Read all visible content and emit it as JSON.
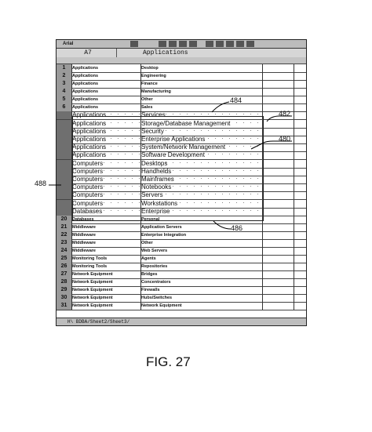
{
  "toolbar": {
    "font": "Arial"
  },
  "formula_bar": {
    "cell_ref": "A7",
    "value": "Applications"
  },
  "rows": [
    {
      "num": "1",
      "a": "Applications",
      "b": "Desktop",
      "style": "small"
    },
    {
      "num": "2",
      "a": "Applications",
      "b": "Engineering",
      "style": "small"
    },
    {
      "num": "3",
      "a": "Applications",
      "b": "Finance",
      "style": "small"
    },
    {
      "num": "4",
      "a": "Applications",
      "b": "Manufacturing",
      "style": "small"
    },
    {
      "num": "5",
      "a": "Applications",
      "b": "Other",
      "style": "small"
    },
    {
      "num": "6",
      "a": "Applications",
      "b": "Sales",
      "style": "small"
    },
    {
      "num": "",
      "a": "Applications",
      "b": "Services",
      "style": "big"
    },
    {
      "num": "",
      "a": "Applications",
      "b": "Storage/Database Management",
      "style": "big"
    },
    {
      "num": "",
      "a": "Applications",
      "b": "Security",
      "style": "big"
    },
    {
      "num": "",
      "a": "Applications",
      "b": "Enterprise Applications",
      "style": "big"
    },
    {
      "num": "",
      "a": "Applications",
      "b": "System/Network Management",
      "style": "big"
    },
    {
      "num": "",
      "a": "Applications",
      "b": "Software Development",
      "style": "big"
    },
    {
      "num": "",
      "a": "Computers",
      "b": "Desktops",
      "style": "big"
    },
    {
      "num": "",
      "a": "Computers",
      "b": "Handhelds",
      "style": "big"
    },
    {
      "num": "",
      "a": "Computers",
      "b": "Mainframes",
      "style": "big"
    },
    {
      "num": "",
      "a": "Computers",
      "b": "Notebooks",
      "style": "big"
    },
    {
      "num": "",
      "a": "Computers",
      "b": "Servers",
      "style": "big"
    },
    {
      "num": "",
      "a": "Computers",
      "b": "Workstations",
      "style": "big"
    },
    {
      "num": "",
      "a": "Databases",
      "b": "Enterprise",
      "style": "big"
    },
    {
      "num": "20",
      "a": "Databases",
      "b": "Personal",
      "style": "small"
    },
    {
      "num": "21",
      "a": "Middleware",
      "b": "Application Servers",
      "style": "small"
    },
    {
      "num": "22",
      "a": "Middleware",
      "b": "Enterprise Integration",
      "style": "small"
    },
    {
      "num": "23",
      "a": "Middleware",
      "b": "Other",
      "style": "small"
    },
    {
      "num": "24",
      "a": "Middleware",
      "b": "Web Servers",
      "style": "small"
    },
    {
      "num": "25",
      "a": "Monitoring Tools",
      "b": "Agents",
      "style": "small"
    },
    {
      "num": "26",
      "a": "Monitoring Tools",
      "b": "Repositories",
      "style": "small"
    },
    {
      "num": "27",
      "a": "Network Equipment",
      "b": "Bridges",
      "style": "small"
    },
    {
      "num": "28",
      "a": "Network Equipment",
      "b": "Concentrators",
      "style": "small"
    },
    {
      "num": "29",
      "a": "Network Equipment",
      "b": "Firewalls",
      "style": "small"
    },
    {
      "num": "30",
      "a": "Network Equipment",
      "b": "Hubs/Switches",
      "style": "small"
    },
    {
      "num": "31",
      "a": "Network Equipment",
      "b": "Network Equipment",
      "style": "small"
    }
  ],
  "sheet_tabs": "H\\ BDBA/Sheet2/Sheet3/",
  "callouts": {
    "c482": "482",
    "c480": "480",
    "c484": "484",
    "c486": "486",
    "c488": "488"
  },
  "caption": "FIG. 27"
}
